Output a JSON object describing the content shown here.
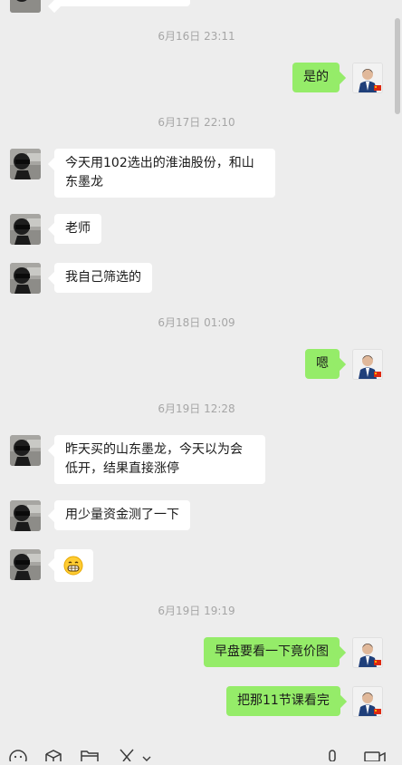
{
  "timestamps": [
    "6月16日 23:11",
    "6月17日 22:10",
    "6月18日 01:09",
    "6月19日 12:28",
    "6月19日 19:19"
  ],
  "messages": {
    "m1": "是的",
    "m2": "今天用102选出的淮油股份，和山东墨龙",
    "m3": "老师",
    "m4": "我自己筛选的",
    "m5": "嗯",
    "m6": "昨天买的山东墨龙，今天以为会低开，结果直接涨停",
    "m7": "用少量资金测了一下",
    "m8": "grinning-face-emoji",
    "m9": "早盘要看一下竟价图",
    "m10": "把那11节课看完"
  },
  "colors": {
    "background": "#ededed",
    "incoming_bubble": "#ffffff",
    "outgoing_bubble": "#95ec69",
    "timestamp_text": "#a6a6a6"
  },
  "toolbar": {
    "icons": [
      "emoji-icon",
      "favorites-icon",
      "folder-icon",
      "screenshot-icon",
      "dropdown-chevron-icon",
      "voice-icon",
      "video-call-icon"
    ]
  }
}
